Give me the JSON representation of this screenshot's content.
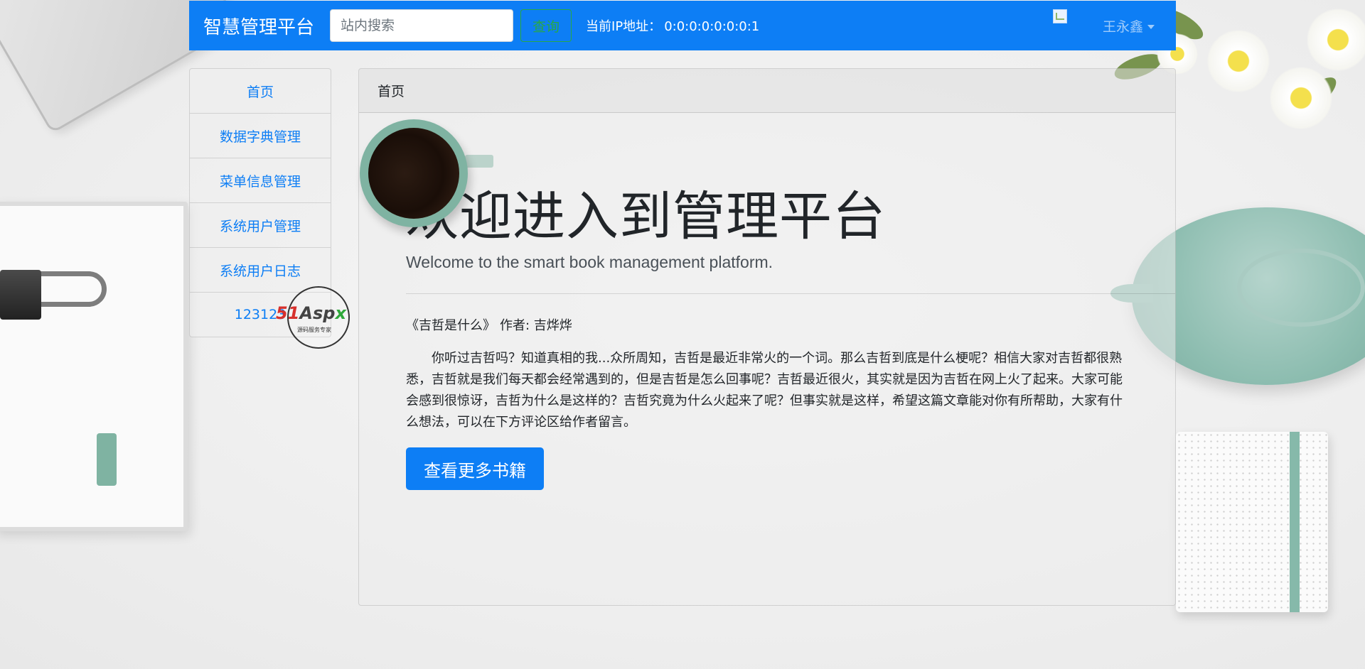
{
  "navbar": {
    "brand": "智慧管理平台",
    "search_placeholder": "站内搜索",
    "search_button": "查询",
    "ip_label": "当前IP地址：",
    "ip_value": "0:0:0:0:0:0:0:1",
    "user_name": "王永鑫"
  },
  "sidebar": {
    "items": [
      {
        "label": "首页"
      },
      {
        "label": "数据字典管理"
      },
      {
        "label": "菜单信息管理"
      },
      {
        "label": "系统用户管理"
      },
      {
        "label": "系统用户日志"
      },
      {
        "label": "123123"
      }
    ]
  },
  "watermark": {
    "brand_51": "51",
    "brand_asp": "Asp",
    "brand_x": "x",
    "tagline": "源码服务专家"
  },
  "main": {
    "header": "首页",
    "title": "欢迎进入到管理平台",
    "subtitle": "Welcome to the smart book management platform.",
    "book_title": "《吉哲是什么》",
    "book_author": "作者: 吉烨烨",
    "paragraph": "你听过吉哲吗？知道真相的我...众所周知，吉哲是最近非常火的一个词。那么吉哲到底是什么梗呢？相信大家对吉哲都很熟悉，吉哲就是我们每天都会经常遇到的，但是吉哲是怎么回事呢？吉哲最近很火，其实就是因为吉哲在网上火了起来。大家可能会感到很惊讶，吉哲为什么是这样的？吉哲究竟为什么火起来了呢？但事实就是这样，希望这篇文章能对你有所帮助，大家有什么想法，可以在下方评论区给作者留言。",
    "more_button": "查看更多书籍"
  },
  "colors": {
    "primary": "#0d7ef5",
    "success": "#28a745",
    "text": "#212529"
  },
  "icons": {
    "avatar": "broken-image-icon",
    "dropdown": "caret-down-icon"
  }
}
